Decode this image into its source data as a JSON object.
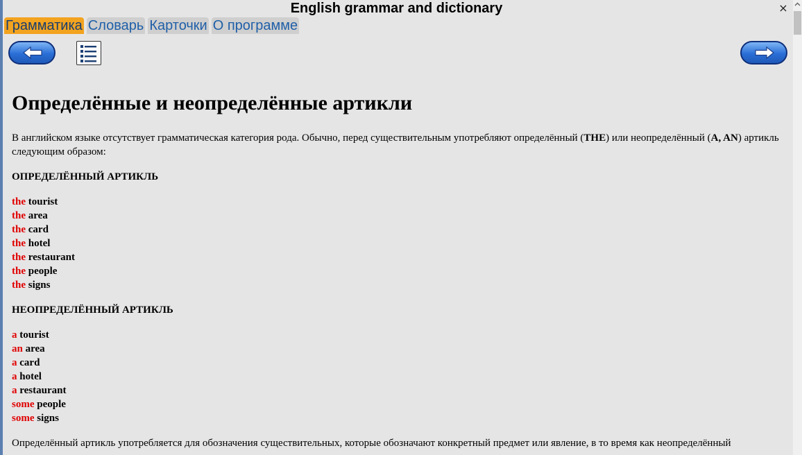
{
  "app": {
    "title": "English grammar and dictionary",
    "close_symbol": "×"
  },
  "tabs": [
    {
      "label": "Грамматика",
      "active": true
    },
    {
      "label": "Словарь",
      "active": false
    },
    {
      "label": "Карточки",
      "active": false
    },
    {
      "label": "О программе",
      "active": false
    }
  ],
  "nav": {
    "prev_icon": "arrow-left-icon",
    "toc_icon": "list-icon",
    "next_icon": "arrow-right-icon"
  },
  "article": {
    "title": "Определённые и неопределённые артикли",
    "intro_pre": "В английском языке отсутствует грамматическая категория рода.  Обычно, перед существительным употребляют определённый (",
    "intro_the": "THE",
    "intro_mid": ") или неопределённый (",
    "intro_a_an": "A, AN",
    "intro_post": ") артикль следующим образом:",
    "definite_heading": "ОПРЕДЕЛЁННЫЙ АРТИКЛЬ",
    "definite_list": [
      {
        "article": "the",
        "noun": "tourist"
      },
      {
        "article": "the",
        "noun": "area"
      },
      {
        "article": "the",
        "noun": "card"
      },
      {
        "article": "the",
        "noun": "hotel"
      },
      {
        "article": "the",
        "noun": "restaurant"
      },
      {
        "article": "the",
        "noun": "people"
      },
      {
        "article": "the",
        "noun": "signs"
      }
    ],
    "indefinite_heading": "НЕОПРЕДЕЛЁННЫЙ АРТИКЛЬ",
    "indefinite_list": [
      {
        "article": "a",
        "noun": "tourist"
      },
      {
        "article": "an",
        "noun": "area"
      },
      {
        "article": "a",
        "noun": "card"
      },
      {
        "article": "a",
        "noun": "hotel"
      },
      {
        "article": "a",
        "noun": "restaurant"
      },
      {
        "article": "some",
        "noun": "people"
      },
      {
        "article": "some",
        "noun": "signs"
      }
    ],
    "closing": "Определённый артикль употребляется для обозначения существительных, которые обозначают конкретный предмет или явление, в то время как неопределённый"
  },
  "colors": {
    "background": "#e6e5e6",
    "active_tab": "#f2a31f",
    "tab_text": "#1f5fa8",
    "article_red": "#e00000",
    "nav_blue": "#2a6fd6"
  }
}
